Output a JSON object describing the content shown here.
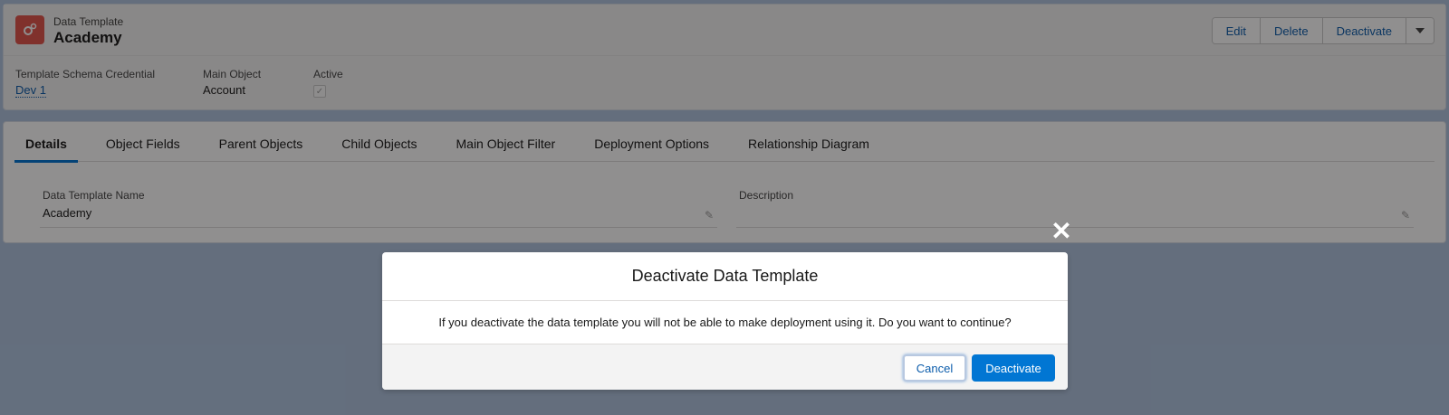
{
  "header": {
    "object_label": "Data Template",
    "record_title": "Academy",
    "actions": [
      "Edit",
      "Delete",
      "Deactivate"
    ],
    "more_icon": "chevron-down-icon"
  },
  "highlights": {
    "credential_label": "Template Schema Credential",
    "credential_value": "Dev 1",
    "main_object_label": "Main Object",
    "main_object_value": "Account",
    "active_label": "Active"
  },
  "tabs": [
    "Details",
    "Object Fields",
    "Parent Objects",
    "Child Objects",
    "Main Object Filter",
    "Deployment Options",
    "Relationship Diagram"
  ],
  "details": {
    "name_label": "Data Template Name",
    "name_value": "Academy",
    "description_label": "Description",
    "description_value": ""
  },
  "modal": {
    "title": "Deactivate Data Template",
    "message": "If you deactivate the data template you will not be able to make deployment using it. Do you want to continue?",
    "cancel_label": "Cancel",
    "confirm_label": "Deactivate"
  },
  "colors": {
    "brand": "#0176d3",
    "icon_bg": "#e2544c"
  }
}
